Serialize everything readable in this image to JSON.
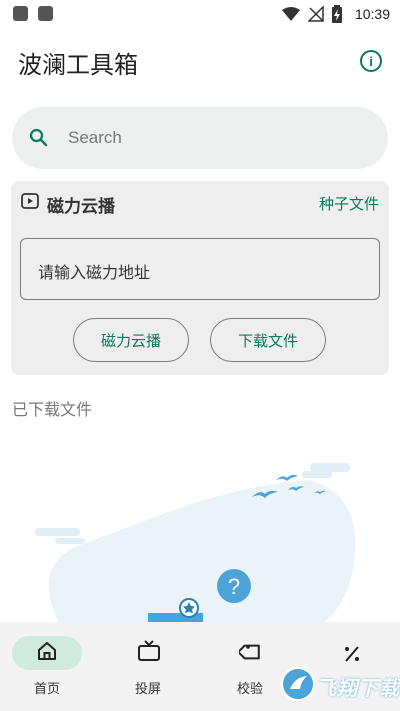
{
  "status_bar": {
    "time": "10:39"
  },
  "header": {
    "title": "波澜工具箱"
  },
  "search": {
    "placeholder": "Search"
  },
  "magnet_card": {
    "title": "磁力云播",
    "torrent_link": "种子文件",
    "input_placeholder": "请输入磁力地址",
    "play_button": "磁力云播",
    "download_button": "下载文件"
  },
  "downloaded_section": {
    "label": "已下载文件"
  },
  "bottom_nav": {
    "items": [
      {
        "label": "首页",
        "icon": "home-icon",
        "selected": true
      },
      {
        "label": "投屏",
        "icon": "tv-icon",
        "selected": false
      },
      {
        "label": "校验",
        "icon": "tag-icon",
        "selected": false
      },
      {
        "label": "",
        "icon": "percent-icon",
        "selected": false
      }
    ]
  },
  "watermark": {
    "text": "飞翔下载"
  },
  "colors": {
    "accent": "#0a7a5a",
    "nav_selected_bg": "#d1eadf",
    "card_bg": "#eeeeee"
  }
}
